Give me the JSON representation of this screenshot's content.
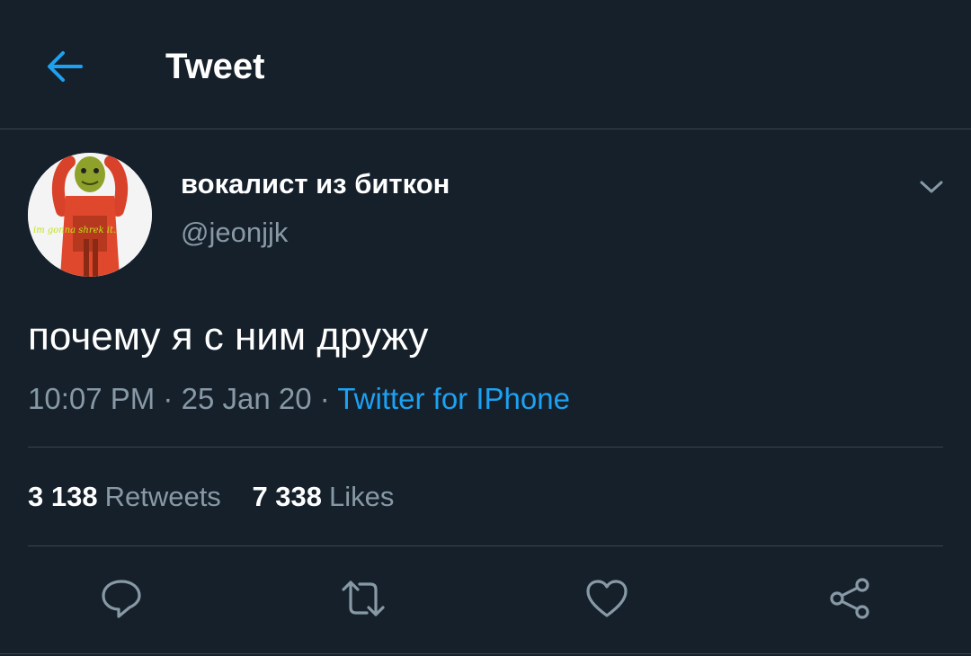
{
  "header": {
    "title": "Tweet",
    "back_icon": "arrow-left-icon"
  },
  "author": {
    "name": "вокалист из биткон",
    "handle": "@jeonjjk",
    "avatar_caption": "im gonna shrek it."
  },
  "tweet": {
    "text": "почему я с ним дружу",
    "time": "10:07 PM",
    "date": "25 Jan 20",
    "separator": "·",
    "source": "Twitter for IPhone"
  },
  "stats": {
    "retweets_count": "3 138",
    "retweets_label": "Retweets",
    "likes_count": "7 338",
    "likes_label": "Likes"
  },
  "actions": [
    "reply-icon",
    "retweet-icon",
    "like-icon",
    "share-icon"
  ],
  "colors": {
    "background": "#15202b",
    "accent": "#1da1f2",
    "secondary_text": "#8899a6",
    "divider": "#38444d"
  }
}
